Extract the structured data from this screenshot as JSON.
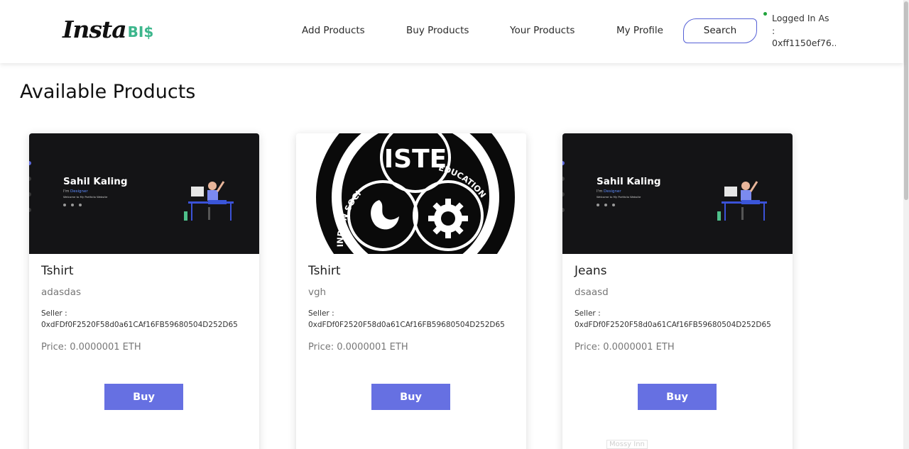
{
  "brand": {
    "name_main": "Insta",
    "name_accent": "BI$"
  },
  "nav": {
    "add_products": "Add Products",
    "buy_products": "Buy Products",
    "your_products": "Your Products",
    "my_profile": "My Profile",
    "search": "Search",
    "login_label": "Logged In As",
    "login_sep": ":",
    "login_address": "0xff1150ef76..."
  },
  "page": {
    "title": "Available Products"
  },
  "portfolio_banner": {
    "name": "Sahil Kaling",
    "role_prefix": "I'm",
    "role": "Designer",
    "tagline": "Welcome to My Portfolio Website"
  },
  "iste_logo": {
    "initials": "ISTE",
    "left_arc": "INDIAN SOCI",
    "right_arc": "EDUCATION"
  },
  "products": [
    {
      "title": "Tshirt",
      "description": "adasdas",
      "seller_label": "Seller :",
      "seller": "0xdFDf0F2520F58d0a61CAf16FB59680504D252D65",
      "price": "Price: 0.0000001 ETH",
      "buy_label": "Buy"
    },
    {
      "title": "Tshirt",
      "description": "vgh",
      "seller_label": "Seller :",
      "seller": "0xdFDf0F2520F58d0a61CAf16FB59680504D252D65",
      "price": "Price: 0.0000001 ETH",
      "buy_label": "Buy"
    },
    {
      "title": "Jeans",
      "description": "dsaasd",
      "seller_label": "Seller :",
      "seller": "0xdFDf0F2520F58d0a61CAf16FB59680504D252D65",
      "price": "Price: 0.0000001 ETH",
      "buy_label": "Buy"
    }
  ],
  "faint_tag": "Mossy Inn",
  "colors": {
    "accent": "#6670e2",
    "brand_green": "#3cb68c",
    "search_border": "#5560d6",
    "online": "#1fa33a",
    "banner_bg": "#141416"
  }
}
